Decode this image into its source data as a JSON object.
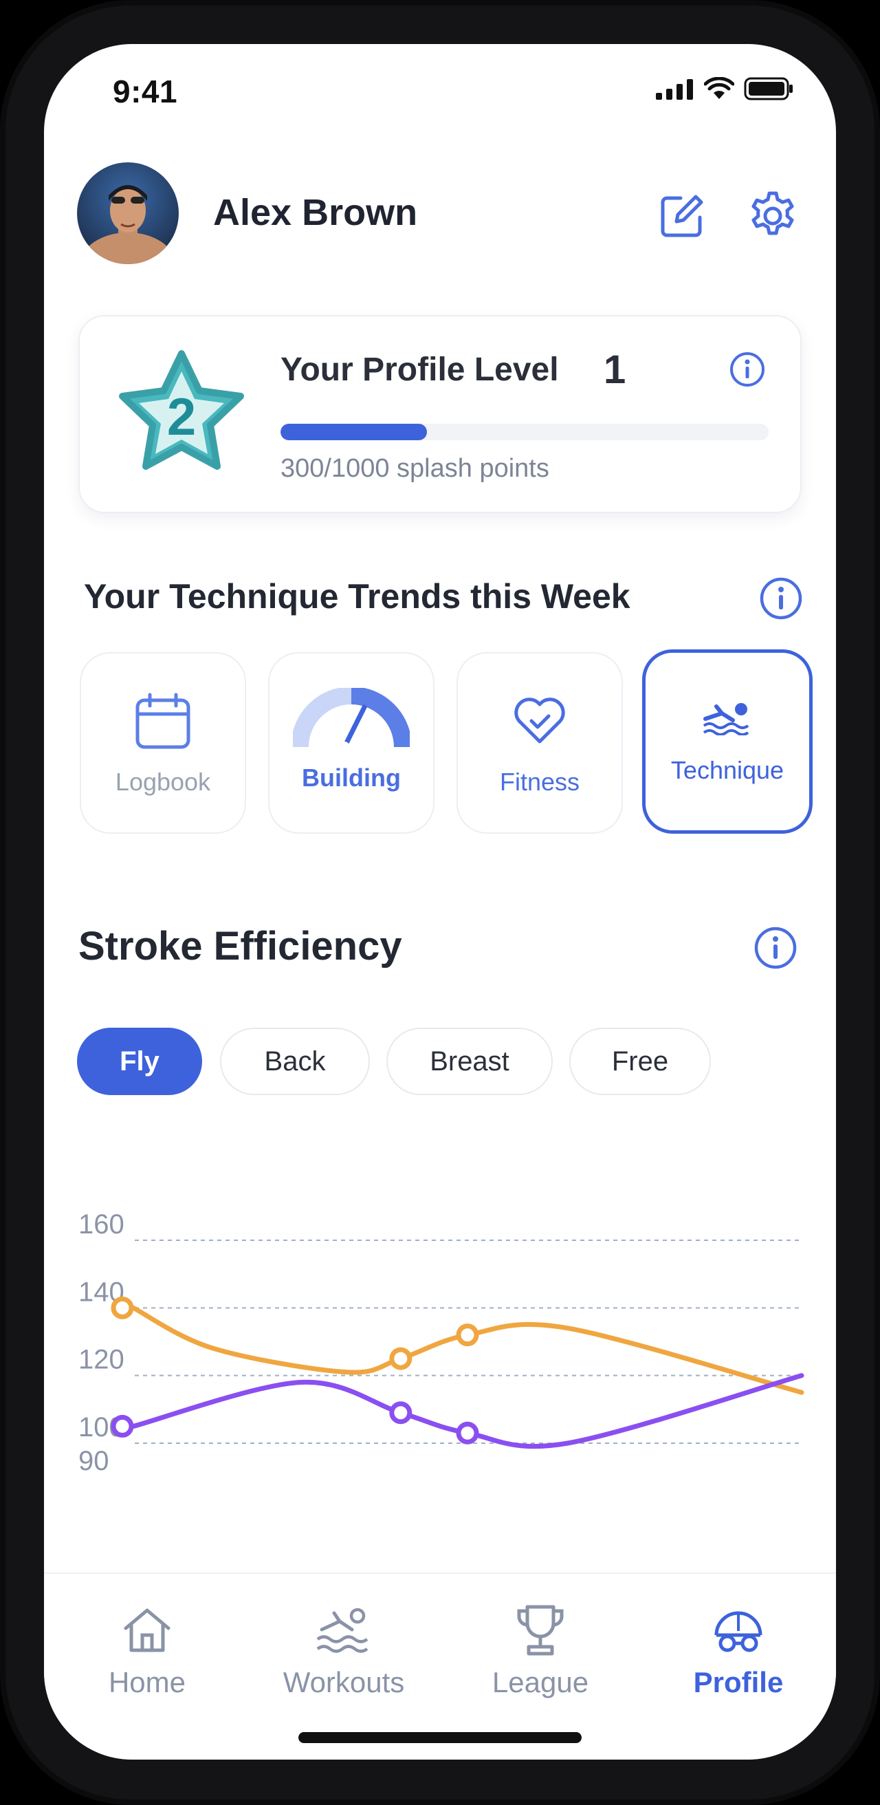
{
  "status": {
    "time": "9:41",
    "icons": [
      "cellular-signal-icon",
      "wifi-icon",
      "battery-icon"
    ]
  },
  "header": {
    "user_name": "Alex Brown",
    "edit_icon": "edit-icon",
    "settings_icon": "gear-icon"
  },
  "level_card": {
    "title": "Your Profile Level",
    "level": "1",
    "badge_number": "2",
    "points_text": "300/1000 splash points",
    "progress": 0.3
  },
  "trends": {
    "title": "Your Technique Trends this Week",
    "tiles": [
      {
        "label": "Logbook",
        "icon": "calendar-icon",
        "active": false
      },
      {
        "label": "Building",
        "icon": "gauge-icon",
        "active": false
      },
      {
        "label": "Fitness",
        "icon": "heart-icon",
        "active": false
      },
      {
        "label": "Technique",
        "icon": "swimmer-icon",
        "active": true
      }
    ]
  },
  "stroke_efficiency": {
    "title": "Stroke Efficiency",
    "tabs": [
      "Fly",
      "Back",
      "Breast",
      "Free"
    ],
    "selected_tab": "Fly"
  },
  "chart_data": {
    "type": "line",
    "yticks": [
      "160",
      "140",
      "120",
      "100",
      "90"
    ],
    "ylim": [
      90,
      160
    ],
    "grid": true,
    "series": [
      {
        "color": "#f0a640",
        "points": [
          [
            0,
            140
          ],
          [
            0.4,
            125
          ],
          [
            0.5,
            132
          ]
        ],
        "curve": [
          [
            0,
            140
          ],
          [
            0.12,
            128
          ],
          [
            0.32,
            121
          ],
          [
            0.4,
            125
          ],
          [
            0.5,
            132
          ],
          [
            0.65,
            134
          ],
          [
            1.0,
            115
          ]
        ]
      },
      {
        "color": "#8a4ff0",
        "points": [
          [
            0,
            105
          ],
          [
            0.4,
            109
          ],
          [
            0.5,
            103
          ]
        ],
        "curve": [
          [
            0,
            105
          ],
          [
            0.25,
            118
          ],
          [
            0.4,
            109
          ],
          [
            0.5,
            103
          ],
          [
            0.65,
            100
          ],
          [
            1.0,
            120
          ]
        ]
      }
    ]
  },
  "nav": {
    "items": [
      {
        "label": "Home",
        "icon": "home-icon",
        "active": false
      },
      {
        "label": "Workouts",
        "icon": "swim-icon",
        "active": false
      },
      {
        "label": "League",
        "icon": "trophy-icon",
        "active": false
      },
      {
        "label": "Profile",
        "icon": "swim-cap-icon",
        "active": true
      }
    ]
  }
}
